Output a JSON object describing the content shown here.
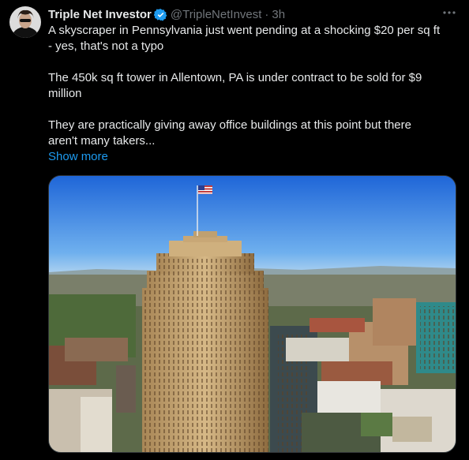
{
  "tweet": {
    "author_name": "Triple Net Investor",
    "handle": "@TripleNetInvest",
    "separator": "·",
    "time": "3h",
    "lines": [
      "A skyscraper in Pennsylvania just went pending at a shocking $20 per sq ft",
      "- yes, that's not a typo",
      "The 450k sq ft tower in Allentown, PA is under contract to be sold for $9",
      "million",
      "They are practically giving away office buildings at this point but there",
      "aren't many takers..."
    ],
    "show_more": "Show more"
  },
  "icons": {
    "verified": "verified-badge-icon",
    "more": "more-options-icon",
    "avatar": "avatar"
  },
  "colors": {
    "background": "#000000",
    "text": "#e7e9ea",
    "muted": "#71767b",
    "link": "#1d9bf0"
  }
}
